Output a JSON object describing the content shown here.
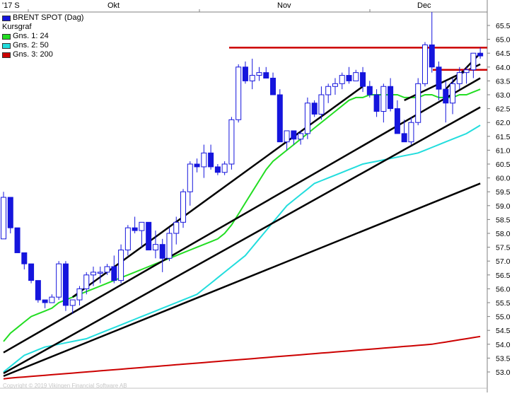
{
  "chart_data": {
    "type": "candlestick",
    "title": "BRENT SPOT (Dag)",
    "subtitle": "Kursgraf",
    "x_tick_labels": [
      "'17 S",
      "Okt",
      "Nov",
      "Dec"
    ],
    "y_ticks": [
      "65.5",
      "65.0",
      "64.5",
      "64.0",
      "63.5",
      "63.0",
      "62.5",
      "62.0",
      "61.5",
      "61.0",
      "60.5",
      "60.0",
      "59.5",
      "59.0",
      "58.5",
      "58.0",
      "57.5",
      "57.0",
      "56.5",
      "56.0",
      "55.5",
      "55.0",
      "54.5",
      "54.0",
      "53.5",
      "53.0"
    ],
    "ylim": [
      52.75,
      66.0
    ],
    "grid": false,
    "legend_position": "top-left",
    "candles": [
      [
        57.8,
        59.5,
        57.8,
        59.3
      ],
      [
        59.3,
        59.2,
        58.0,
        58.2
      ],
      [
        58.2,
        58.2,
        57.3,
        57.3
      ],
      [
        57.3,
        57.3,
        56.7,
        56.9
      ],
      [
        56.9,
        56.9,
        56.2,
        56.3
      ],
      [
        56.3,
        56.3,
        55.5,
        55.6
      ],
      [
        55.6,
        55.6,
        55.3,
        55.5
      ],
      [
        55.5,
        55.8,
        55.5,
        55.7
      ],
      [
        55.7,
        57.0,
        55.6,
        56.9
      ],
      [
        56.9,
        57.0,
        55.2,
        55.4
      ],
      [
        55.4,
        55.6,
        55.1,
        55.6
      ],
      [
        55.6,
        56.1,
        55.4,
        56.0
      ],
      [
        56.0,
        56.6,
        55.8,
        56.5
      ],
      [
        56.5,
        56.8,
        56.1,
        56.6
      ],
      [
        56.6,
        56.8,
        56.2,
        56.6
      ],
      [
        56.6,
        56.9,
        56.5,
        56.8
      ],
      [
        56.8,
        57.2,
        56.2,
        56.3
      ],
      [
        56.3,
        57.6,
        56.2,
        57.4
      ],
      [
        57.4,
        58.3,
        57.2,
        58.2
      ],
      [
        58.2,
        58.6,
        58.0,
        58.1
      ],
      [
        58.1,
        58.4,
        57.5,
        58.4
      ],
      [
        58.4,
        58.4,
        57.4,
        57.4
      ],
      [
        57.4,
        58.1,
        57.1,
        57.6
      ],
      [
        57.6,
        57.8,
        56.6,
        57.1
      ],
      [
        57.1,
        58.2,
        57.0,
        58.0
      ],
      [
        58.0,
        58.6,
        57.6,
        58.4
      ],
      [
        58.4,
        59.6,
        58.2,
        59.5
      ],
      [
        59.5,
        60.6,
        59.0,
        60.5
      ],
      [
        60.5,
        60.7,
        60.2,
        60.4
      ],
      [
        60.4,
        61.2,
        60.0,
        60.9
      ],
      [
        60.9,
        61.2,
        60.3,
        60.4
      ],
      [
        60.4,
        60.5,
        60.1,
        60.2
      ],
      [
        60.2,
        60.6,
        60.1,
        60.5
      ],
      [
        60.5,
        62.2,
        60.3,
        62.1
      ],
      [
        62.1,
        64.1,
        62.0,
        64.0
      ],
      [
        64.0,
        64.2,
        63.4,
        63.5
      ],
      [
        63.5,
        64.3,
        63.2,
        63.7
      ],
      [
        63.7,
        64.0,
        63.5,
        63.8
      ],
      [
        63.8,
        64.0,
        63.6,
        63.6
      ],
      [
        63.6,
        63.8,
        63.0,
        63.0
      ],
      [
        63.0,
        63.2,
        61.4,
        61.3
      ],
      [
        61.3,
        61.6,
        61.0,
        61.7
      ],
      [
        61.7,
        61.7,
        61.2,
        61.4
      ],
      [
        61.4,
        61.7,
        61.2,
        61.6
      ],
      [
        61.6,
        62.9,
        61.4,
        62.7
      ],
      [
        62.7,
        62.8,
        62.2,
        62.3
      ],
      [
        62.3,
        63.3,
        62.1,
        63.0
      ],
      [
        63.0,
        63.4,
        62.7,
        63.3
      ],
      [
        63.3,
        63.6,
        63.0,
        63.4
      ],
      [
        63.4,
        63.8,
        63.2,
        63.7
      ],
      [
        63.7,
        64.0,
        63.4,
        63.5
      ],
      [
        63.5,
        63.9,
        63.6,
        63.8
      ],
      [
        63.8,
        64.0,
        63.1,
        63.3
      ],
      [
        63.3,
        63.5,
        62.9,
        63.0
      ],
      [
        63.0,
        63.2,
        62.2,
        62.4
      ],
      [
        62.4,
        63.4,
        62.0,
        63.3
      ],
      [
        63.3,
        63.6,
        62.4,
        62.5
      ],
      [
        62.5,
        62.8,
        61.6,
        61.6
      ],
      [
        61.6,
        62.1,
        61.3,
        61.3
      ],
      [
        61.3,
        62.2,
        61.2,
        62.0
      ],
      [
        62.0,
        63.6,
        61.9,
        63.4
      ],
      [
        63.4,
        64.9,
        63.3,
        64.8
      ],
      [
        64.8,
        66.0,
        63.8,
        64.0
      ],
      [
        64.0,
        64.2,
        62.8,
        63.2
      ],
      [
        63.2,
        63.5,
        62.0,
        62.7
      ],
      [
        62.7,
        63.6,
        62.3,
        63.4
      ],
      [
        63.4,
        64.0,
        63.2,
        63.8
      ],
      [
        63.8,
        64.0,
        63.4,
        63.9
      ],
      [
        63.9,
        64.5,
        63.6,
        64.5
      ],
      [
        64.5,
        64.7,
        64.3,
        64.4
      ]
    ],
    "horizontal_levels": [
      {
        "value": 64.7,
        "color": "#cc0000"
      },
      {
        "value": 63.9,
        "color": "#cc0000"
      }
    ],
    "trendlines": [
      {
        "from": [
          0,
          52.95
        ],
        "to": [
          69,
          62.55
        ]
      },
      {
        "from": [
          0,
          53.7
        ],
        "to": [
          69,
          63.6
        ]
      },
      {
        "from": [
          0,
          52.85
        ],
        "to": [
          69,
          59.8
        ]
      },
      {
        "from": [
          10,
          55.7
        ],
        "to": [
          52,
          63.3
        ]
      },
      {
        "from": [
          58,
          62.8
        ],
        "to": [
          69,
          64.1
        ]
      },
      {
        "from": [
          64,
          63.2
        ],
        "to": [
          69,
          64.5
        ]
      }
    ],
    "series": [
      {
        "name": "Gns. 1: 24",
        "color": "#22dd22",
        "values": [
          54.1,
          54.4,
          54.6,
          54.8,
          55.0,
          55.1,
          55.2,
          55.3,
          55.5,
          55.6,
          55.7,
          55.8,
          55.9,
          56.0,
          56.1,
          56.2,
          56.3,
          56.4,
          56.5,
          56.6,
          56.7,
          56.8,
          56.9,
          57.0,
          57.1,
          57.2,
          57.3,
          57.4,
          57.5,
          57.6,
          57.7,
          57.8,
          58.0,
          58.3,
          58.7,
          59.1,
          59.5,
          59.9,
          60.3,
          60.6,
          60.8,
          61.0,
          61.2,
          61.4,
          61.6,
          61.8,
          62.0,
          62.2,
          62.4,
          62.6,
          62.8,
          62.9,
          62.9,
          63.0,
          63.0,
          63.0,
          63.0,
          63.0,
          62.9,
          62.9,
          62.9,
          63.0,
          63.0,
          62.9,
          62.9,
          62.9,
          63.0,
          63.0,
          63.1,
          63.2
        ]
      },
      {
        "name": "Gns. 2: 50",
        "color": "#22dddd",
        "values": [
          53.0,
          53.2,
          53.4,
          53.6,
          53.7,
          53.8,
          53.9,
          53.95,
          54.0,
          54.05,
          54.1,
          54.15,
          54.2,
          54.3,
          54.4,
          54.5,
          54.6,
          54.7,
          54.8,
          54.9,
          55.0,
          55.1,
          55.2,
          55.3,
          55.4,
          55.5,
          55.6,
          55.7,
          55.8,
          56.0,
          56.2,
          56.4,
          56.6,
          56.8,
          57.0,
          57.2,
          57.5,
          57.8,
          58.1,
          58.4,
          58.7,
          59.0,
          59.2,
          59.4,
          59.6,
          59.8,
          59.9,
          60.0,
          60.1,
          60.2,
          60.3,
          60.4,
          60.5,
          60.55,
          60.6,
          60.65,
          60.7,
          60.75,
          60.8,
          60.85,
          60.9,
          61.0,
          61.1,
          61.2,
          61.3,
          61.4,
          61.5,
          61.6,
          61.75,
          61.9
        ]
      },
      {
        "name": "Gns. 3: 200",
        "color": "#cc0000",
        "values": [
          52.75,
          52.78,
          52.8,
          52.82,
          52.84,
          52.86,
          52.88,
          52.9,
          52.92,
          52.94,
          52.96,
          52.98,
          53.0,
          53.02,
          53.04,
          53.06,
          53.08,
          53.1,
          53.12,
          53.14,
          53.16,
          53.18,
          53.2,
          53.22,
          53.24,
          53.26,
          53.28,
          53.3,
          53.32,
          53.34,
          53.36,
          53.38,
          53.4,
          53.42,
          53.44,
          53.46,
          53.48,
          53.5,
          53.52,
          53.54,
          53.56,
          53.58,
          53.6,
          53.62,
          53.64,
          53.66,
          53.68,
          53.7,
          53.72,
          53.74,
          53.76,
          53.78,
          53.8,
          53.82,
          53.84,
          53.86,
          53.88,
          53.9,
          53.92,
          53.94,
          53.96,
          53.98,
          54.0,
          54.04,
          54.08,
          54.12,
          54.16,
          54.2,
          54.24,
          54.28
        ]
      }
    ],
    "colors": {
      "candle_down": "#1515dd",
      "candle_up": "#ffffff",
      "candle_outline": "#1515dd",
      "trendline": "#000000",
      "axis": "#808080"
    }
  },
  "watermark": "Copyright © 2019 Vikingen Financial Software AB"
}
